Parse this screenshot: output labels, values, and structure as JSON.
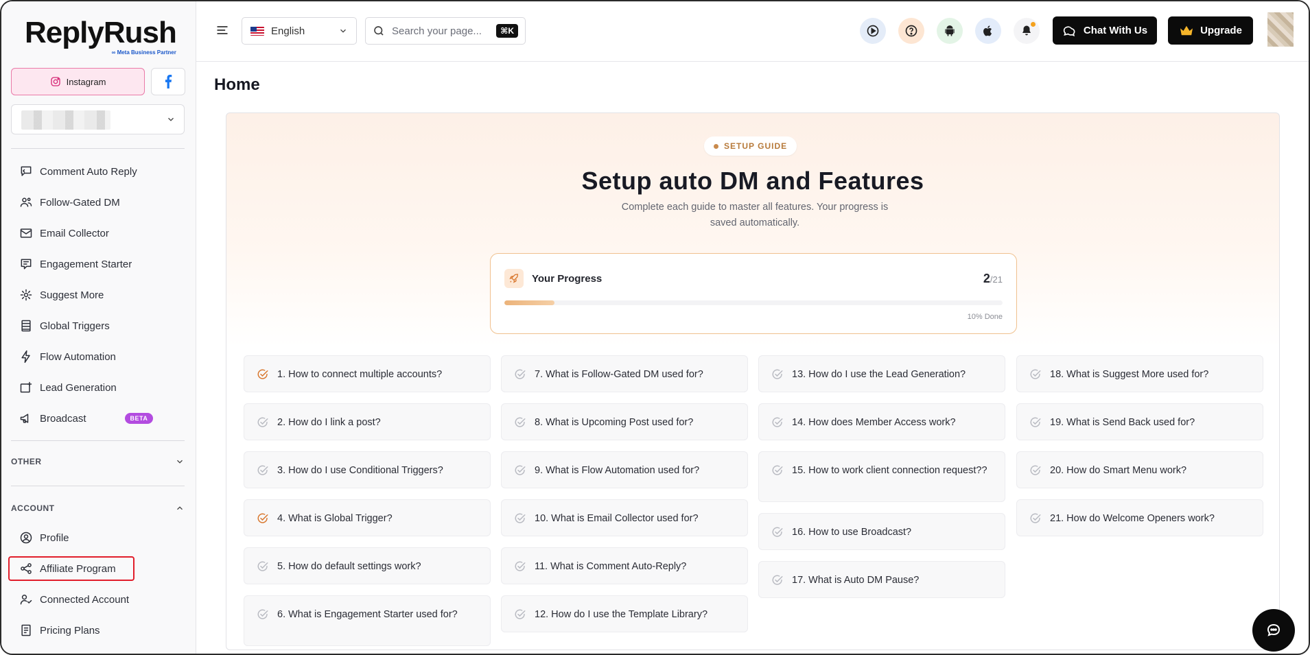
{
  "brand": {
    "name": "ReplyRush",
    "tagline": "Meta Business Partner"
  },
  "platforms": {
    "instagram_label": "Instagram"
  },
  "nav": [
    {
      "label": "Comment Auto Reply",
      "icon": "comment-reply-icon"
    },
    {
      "label": "Follow-Gated DM",
      "icon": "users-icon"
    },
    {
      "label": "Email Collector",
      "icon": "mail-icon"
    },
    {
      "label": "Engagement Starter",
      "icon": "chat-list-icon"
    },
    {
      "label": "Suggest More",
      "icon": "gear-sparkle-icon"
    },
    {
      "label": "Global Triggers",
      "icon": "list-icon"
    },
    {
      "label": "Flow Automation",
      "icon": "bolt-icon"
    },
    {
      "label": "Lead Generation",
      "icon": "lead-icon"
    },
    {
      "label": "Broadcast",
      "icon": "megaphone-icon",
      "badge": "BETA"
    }
  ],
  "sections": {
    "other": "OTHER",
    "account": "ACCOUNT"
  },
  "account_nav": [
    {
      "label": "Profile",
      "icon": "profile-icon"
    },
    {
      "label": "Affiliate Program",
      "icon": "share-icon"
    },
    {
      "label": "Connected Account",
      "icon": "user-check-icon"
    },
    {
      "label": "Pricing Plans",
      "icon": "receipt-icon"
    }
  ],
  "header": {
    "language": "English",
    "search_placeholder": "Search your page...",
    "search_shortcut": "⌘K",
    "chat_button": "Chat With Us",
    "upgrade_button": "Upgrade"
  },
  "colors": {
    "accent": "#c98a4c",
    "checked": "#d9782f",
    "unchecked": "#b9bbc2"
  },
  "page": {
    "title": "Home"
  },
  "guide": {
    "pill": "SETUP GUIDE",
    "title": "Setup auto DM and Features",
    "subtitle": "Complete each guide to master all features. Your progress is saved automatically.",
    "progress": {
      "label": "Your Progress",
      "done": "2",
      "total": "/21",
      "percent_text": "10% Done",
      "fraction": 0.1
    }
  },
  "questions": [
    {
      "text": "1. How to connect multiple accounts?",
      "done": true
    },
    {
      "text": "2. How do I link a post?",
      "done": false
    },
    {
      "text": "3. How do I use Conditional Triggers?",
      "done": false
    },
    {
      "text": "4. What is Global Trigger?",
      "done": true
    },
    {
      "text": "5. How do default settings work?",
      "done": false
    },
    {
      "text": "6. What is Engagement Starter used for?",
      "done": false
    },
    {
      "text": "7. What is Follow-Gated DM used for?",
      "done": false
    },
    {
      "text": "8. What is Upcoming Post used for?",
      "done": false
    },
    {
      "text": "9. What is Flow Automation used for?",
      "done": false
    },
    {
      "text": "10. What is Email Collector used for?",
      "done": false
    },
    {
      "text": "11. What is Comment Auto-Reply?",
      "done": false
    },
    {
      "text": "12. How do I use the Template Library?",
      "done": false
    },
    {
      "text": "13. How do I use the Lead Generation?",
      "done": false
    },
    {
      "text": "14. How does Member Access work?",
      "done": false
    },
    {
      "text": "15. How to work client connection request??",
      "done": false
    },
    {
      "text": "16. How to use Broadcast?",
      "done": false
    },
    {
      "text": "17. What is Auto DM Pause?",
      "done": false
    },
    {
      "text": "18. What is Suggest More used for?",
      "done": false
    },
    {
      "text": "19. What is Send Back used for?",
      "done": false
    },
    {
      "text": "20. How do Smart Menu work?",
      "done": false
    },
    {
      "text": "21. How do Welcome Openers work?",
      "done": false
    }
  ]
}
